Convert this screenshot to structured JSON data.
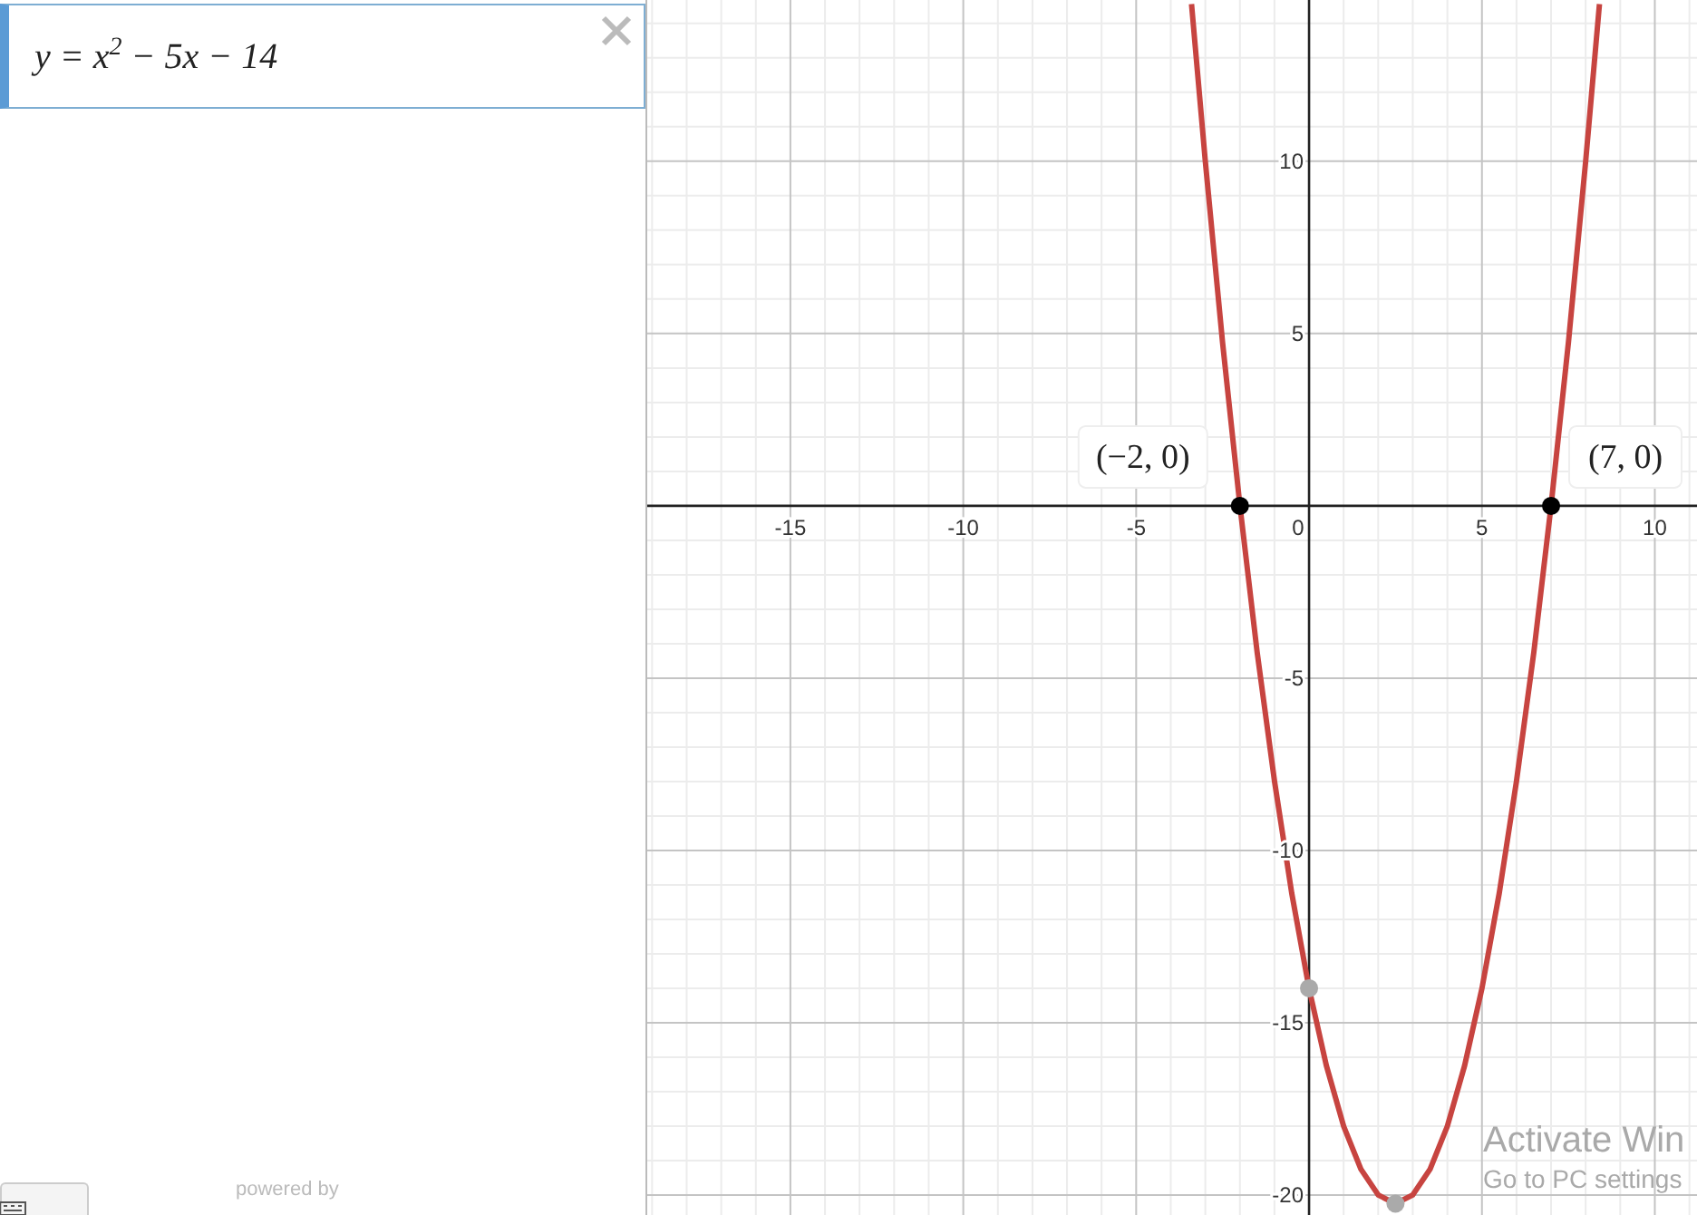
{
  "expression_list": {
    "items": [
      {
        "expression": "y = x$^{2}$ − 5x − 14",
        "selected": true
      }
    ]
  },
  "footer": {
    "powered_by": "powered by"
  },
  "graph": {
    "chart_data": {
      "type": "line",
      "grid": true,
      "xlim": [
        -19.14,
        11.22
      ],
      "ylim": [
        -20.58,
        14.68
      ],
      "xticks": [
        -15,
        -10,
        -5,
        0,
        5,
        10
      ],
      "yticks": [
        -20,
        -15,
        -10,
        -5,
        5,
        10
      ],
      "x": [
        -3.4,
        -3,
        -2.5,
        -2,
        -1.5,
        -1,
        -0.5,
        0,
        0.5,
        1,
        1.5,
        2,
        2.5,
        3,
        3.5,
        4,
        4.5,
        5,
        5.5,
        6,
        6.5,
        7,
        7.5,
        8,
        8.4
      ],
      "series": [
        {
          "color": "#c74440",
          "values": [
            14.56,
            10,
            4.75,
            0,
            -4.25,
            -8,
            -11.25,
            -14,
            -16.25,
            -18,
            -19.25,
            -20,
            -20.25,
            -20,
            -19.25,
            -18,
            -16.25,
            -14,
            -11.25,
            -8,
            -4.25,
            0,
            4.75,
            10,
            14.56
          ]
        }
      ],
      "annotations": [
        {
          "x": -2,
          "y": 0,
          "text": "(−2, 0)"
        },
        {
          "x": 7,
          "y": 0,
          "text": "(7, 0)"
        }
      ]
    }
  },
  "os_overlay": {
    "title": "Activate Win",
    "subtitle": "Go to PC settings"
  }
}
